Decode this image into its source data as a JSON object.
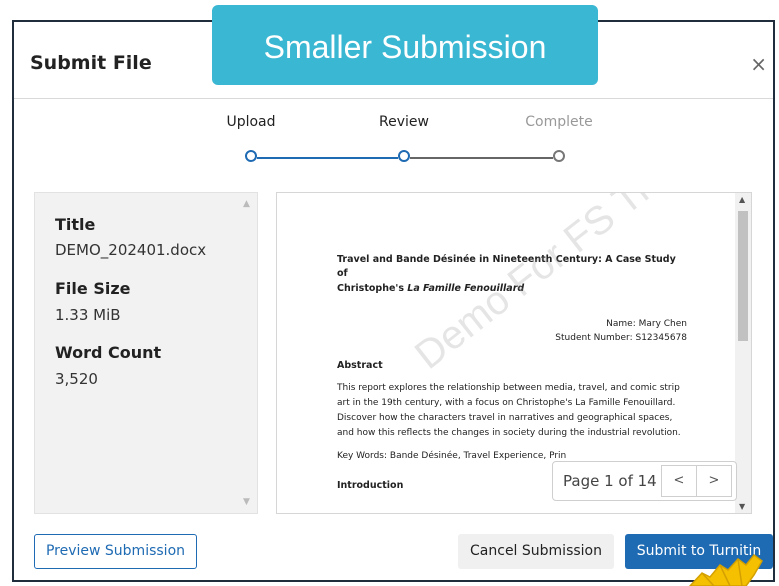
{
  "banner": {
    "text": "Smaller Submission",
    "color": "#3ab7d2"
  },
  "dialog": {
    "title": "Submit File",
    "close_glyph": "×"
  },
  "steps": [
    {
      "label": "Upload",
      "state": "active"
    },
    {
      "label": "Review",
      "state": "active"
    },
    {
      "label": "Complete",
      "state": "inactive"
    }
  ],
  "file_info": {
    "title_label": "Title",
    "title_value": "DEMO_202401.docx",
    "size_label": "File Size",
    "size_value": "1.33 MiB",
    "count_label": "Word Count",
    "count_value": "3,520"
  },
  "document": {
    "title_line1": "Travel and Bande Désinée in Nineteenth Century: A Case Study of",
    "title_line2_plain": "Christophe's ",
    "title_line2_italic": "La Famille Fenouillard",
    "author_name": "Name: Mary Chen",
    "student_number": "Student Number: S12345678",
    "abstract_heading": "Abstract",
    "abstract_text": "This report explores the relationship between media, travel, and comic strip art in the 19th century, with a focus on Christophe's La Famille Fenouillard. Discover how the characters travel in narratives and geographical spaces, and how this reflects the changes in society during the industrial revolution.",
    "keywords": "Key Words: Bande Désinée, Travel Experience, Prin",
    "intro_heading": "Introduction",
    "watermark": "Demo For FS Traini"
  },
  "pager": {
    "text": "Page 1 of 14",
    "prev_glyph": "<",
    "next_glyph": ">"
  },
  "buttons": {
    "preview": "Preview Submission",
    "cancel": "Cancel Submission",
    "submit": "Submit to Turnitin"
  },
  "colors": {
    "accent": "#1e6ab3",
    "pointer": "#f5c000"
  }
}
